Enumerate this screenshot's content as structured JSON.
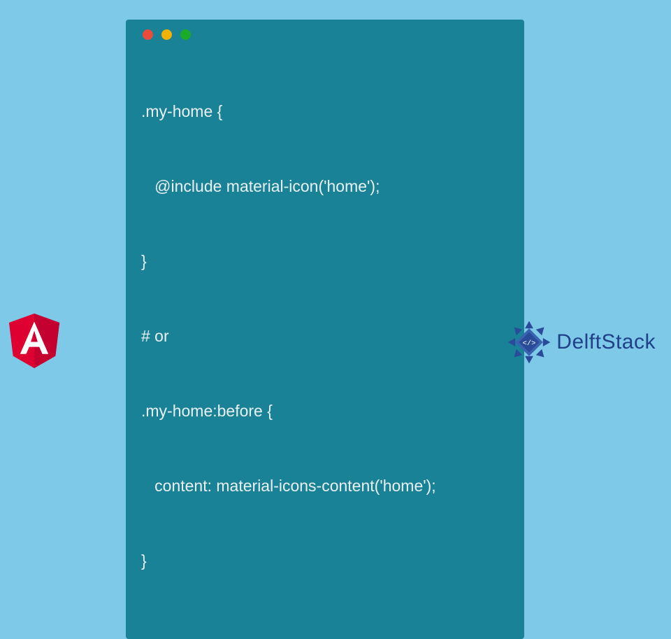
{
  "code": {
    "lines": [
      ".my-home {",
      "   @include material-icon('home');",
      "}",
      "# or",
      ".my-home:before {",
      "   content: material-icons-content('home');",
      "}"
    ]
  },
  "brand": {
    "name": "DelftStack",
    "angular_letter": "A"
  },
  "colors": {
    "page_bg": "#7ec9e8",
    "card_bg": "#1a8296",
    "code_text": "#e8f0f2",
    "brand_text": "#20418a",
    "angular_red": "#dd0031",
    "angular_dark": "#c3002f"
  }
}
